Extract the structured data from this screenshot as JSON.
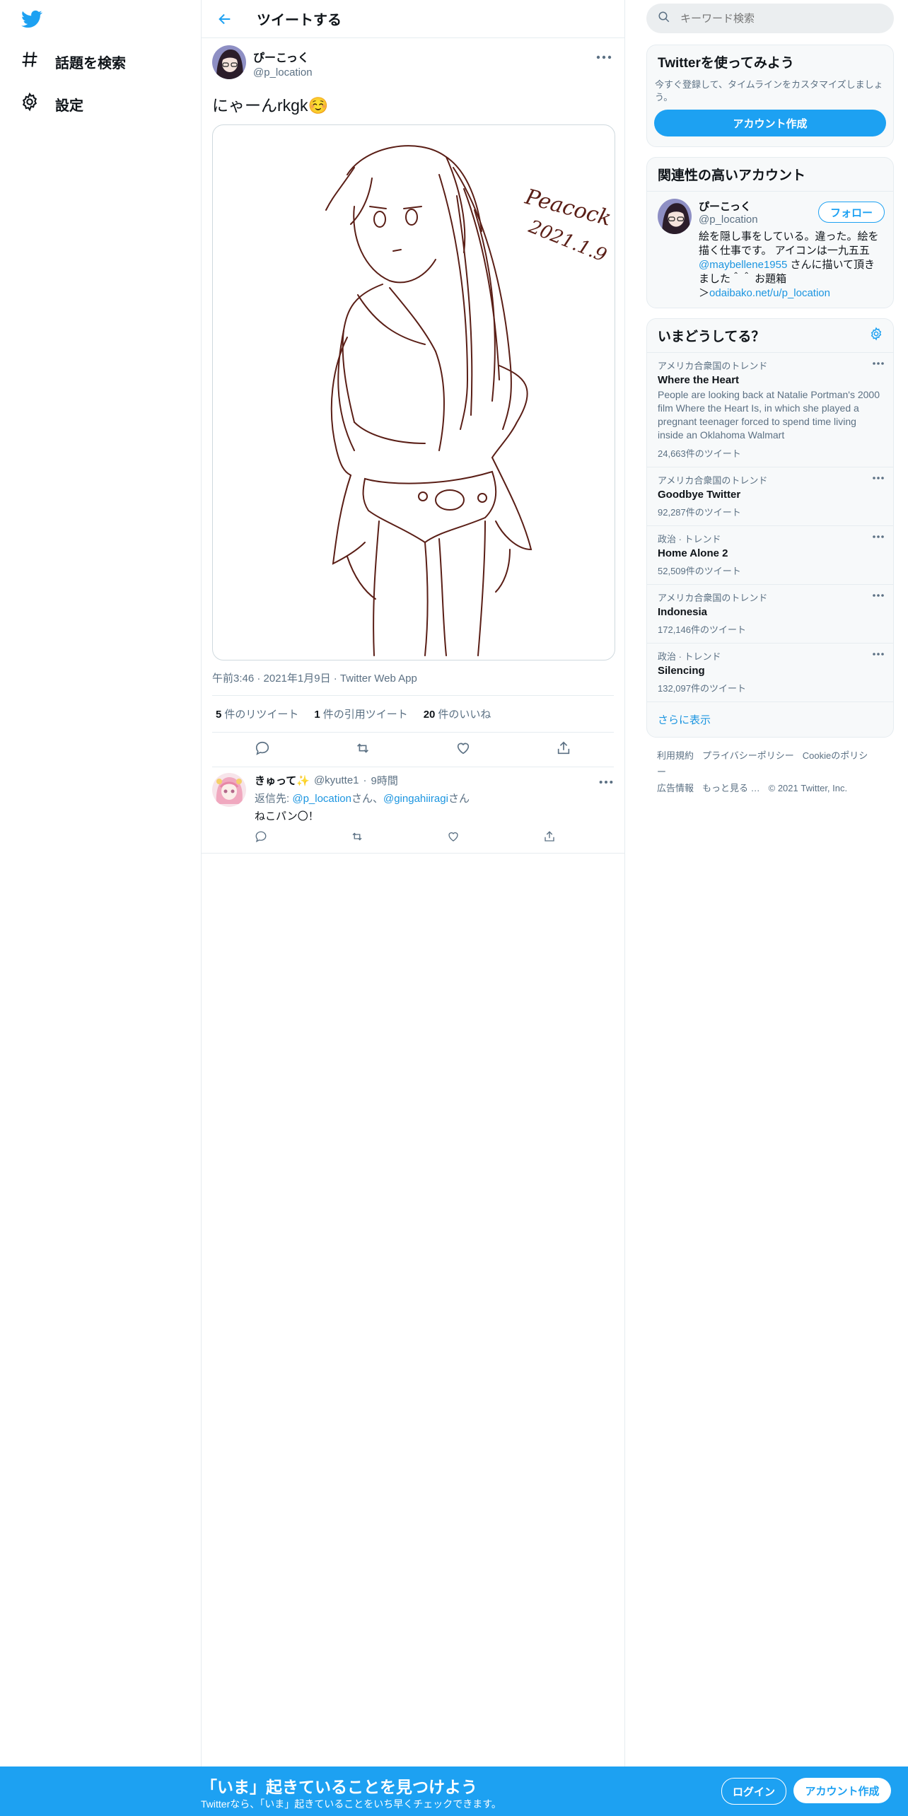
{
  "nav": {
    "explore_label": "話題を検索",
    "settings_label": "設定"
  },
  "header": {
    "title": "ツイートする"
  },
  "tweet": {
    "author_name": "ぴーこっく",
    "author_handle": "@p_location",
    "text": "にゃーんrkgk☺️",
    "media_signature": "Peacock",
    "media_date": "2021.1.9",
    "meta": "午前3:46 · 2021年1月9日 · Twitter Web App",
    "retweets_count": "5",
    "retweets_label": "件のリツイート",
    "quotes_count": "1",
    "quotes_label": "件の引用ツイート",
    "likes_count": "20",
    "likes_label": "件のいいね"
  },
  "reply": {
    "name": "きゅって✨",
    "handle": "@kyutte1",
    "time": "9時間",
    "replying_to_prefix": "返信先: ",
    "mention1": "@p_location",
    "honorific1": "さん、",
    "mention2": "@gingahiiragi",
    "honorific2": "さん",
    "text": "ねこパン〇！"
  },
  "sidebar": {
    "search_placeholder": "キーワード検索",
    "signup_card": {
      "title": "Twitterを使ってみよう",
      "desc": "今すぐ登録して、タイムラインをカスタマイズしましょう。",
      "button": "アカウント作成"
    },
    "relevant": {
      "title": "関連性の高いアカウント",
      "name": "ぴーこっく",
      "handle": "@p_location",
      "follow": "フォロー",
      "bio_1": "絵を隠し事をしている。違った。絵を描く仕事です。 アイコンは一九五五",
      "bio_mention": "@maybellene1955",
      "bio_2": " さんに描いて頂きました＾＾ お題箱",
      "bio_3": "＞",
      "bio_link": "odaibako.net/u/p_location"
    },
    "trends": {
      "title": "いまどうしてる？",
      "items": [
        {
          "context": "アメリカ合衆国のトレンド",
          "name": "Where the Heart",
          "desc": "People are looking back at Natalie Portman's 2000 film Where the Heart Is, in which she played a pregnant teenager forced to spend time living inside an Oklahoma Walmart",
          "count": "24,663件のツイート"
        },
        {
          "context": "アメリカ合衆国のトレンド",
          "name": "Goodbye Twitter",
          "desc": "",
          "count": "92,287件のツイート"
        },
        {
          "context": "政治 · トレンド",
          "name": "Home Alone 2",
          "desc": "",
          "count": "52,509件のツイート"
        },
        {
          "context": "アメリカ合衆国のトレンド",
          "name": "Indonesia",
          "desc": "",
          "count": "172,146件のツイート"
        },
        {
          "context": "政治 · トレンド",
          "name": "Silencing",
          "desc": "",
          "count": "132,097件のツイート"
        }
      ],
      "show_more": "さらに表示"
    },
    "footer": {
      "links": [
        "利用規約",
        "プライバシーポリシー",
        "Cookieのポリシー",
        "広告情報",
        "もっと見る …"
      ],
      "copyright": "© 2021 Twitter, Inc."
    }
  },
  "bottom_bar": {
    "title": "「いま」起きていることを見つけよう",
    "subtitle": "Twitterなら、「いま」起きていることをいち早くチェックできます。",
    "login": "ログイン",
    "signup": "アカウント作成"
  },
  "colors": {
    "accent": "#1da1f2",
    "link": "#1b95e0",
    "muted": "#5b7083",
    "sketch": "#5a1e16"
  }
}
